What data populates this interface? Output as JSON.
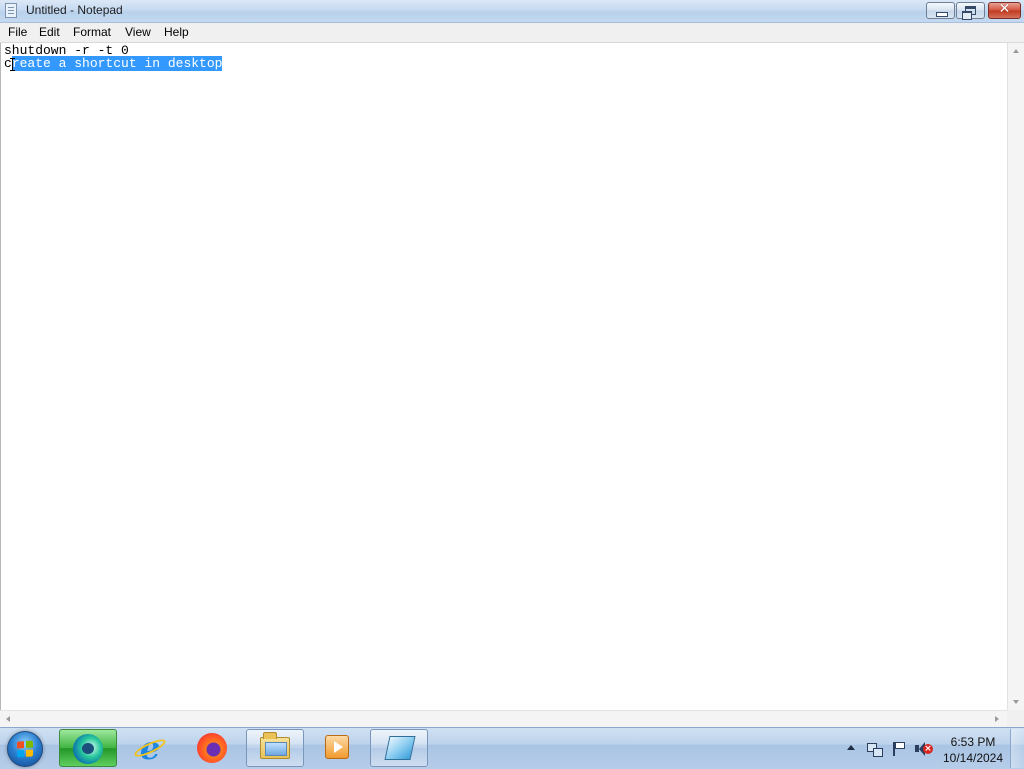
{
  "window": {
    "title": "Untitled - Notepad"
  },
  "menu": {
    "file": "File",
    "edit": "Edit",
    "format": "Format",
    "view": "View",
    "help": "Help"
  },
  "editor": {
    "line1": "shutdown -r -t 0",
    "line2_unselected": "c",
    "line2_selected": "reate a shortcut in desktop"
  },
  "taskbar": {
    "pinned": [
      {
        "icon": "edge-beta-icon"
      },
      {
        "icon": "internet-explorer-icon"
      },
      {
        "icon": "firefox-icon"
      },
      {
        "icon": "windows-explorer-icon"
      },
      {
        "icon": "media-player-icon"
      },
      {
        "icon": "notepad-icon"
      }
    ]
  },
  "tray": {
    "time": "6:53 PM",
    "date": "10/14/2024"
  },
  "colors": {
    "selection": "#3399ff",
    "close_button": "#c0371e",
    "taskbar": "#b6cde9"
  }
}
